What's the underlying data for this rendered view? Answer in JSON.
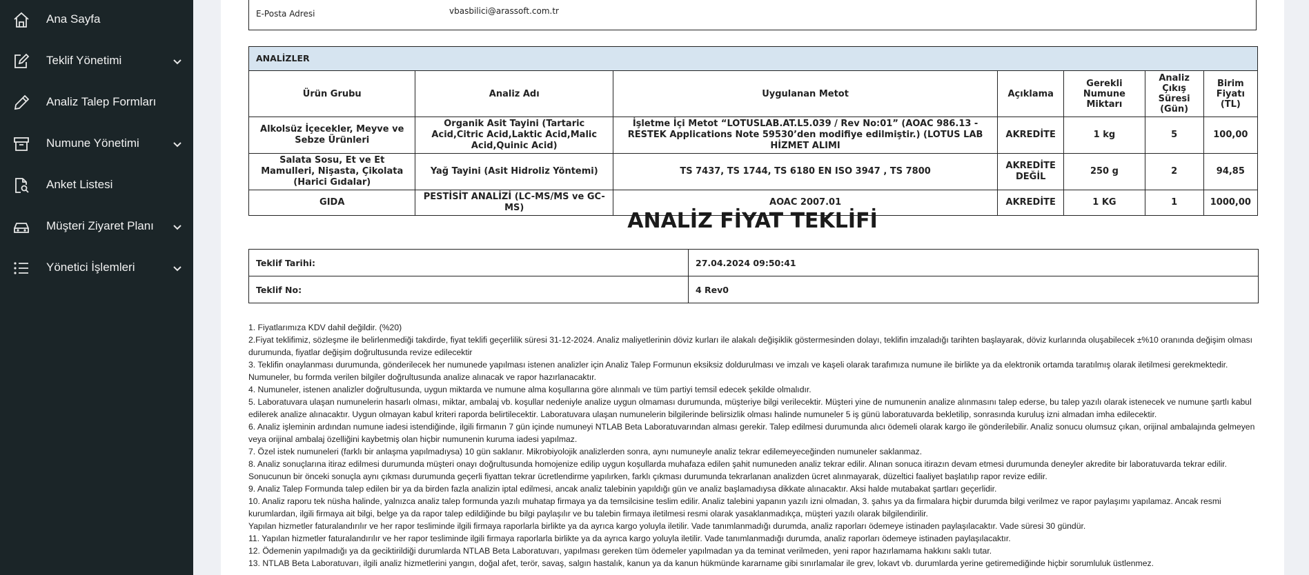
{
  "sidebar": {
    "items": [
      {
        "label": "Ana Sayfa",
        "icon": "home-icon",
        "has_submenu": false
      },
      {
        "label": "Teklif Yönetimi",
        "icon": "edit-icon",
        "has_submenu": true
      },
      {
        "label": "Analiz Talep Formları",
        "icon": "pencil-icon",
        "has_submenu": false
      },
      {
        "label": "Numune Yönetimi",
        "icon": "archive-icon",
        "has_submenu": true
      },
      {
        "label": "Anket Listesi",
        "icon": "document-search-icon",
        "has_submenu": false
      },
      {
        "label": "Müşteri Ziyaret Planı",
        "icon": "car-icon",
        "has_submenu": true
      },
      {
        "label": "Yönetici İşlemleri",
        "icon": "list-icon",
        "has_submenu": true
      }
    ]
  },
  "email": {
    "label": "E-Posta Adresi",
    "value": "vbasbilici@arassoft.com.tr"
  },
  "analyses": {
    "caption": "ANALİZLER",
    "headers": [
      "Ürün Grubu",
      "Analiz Adı",
      "Uygulanan Metot",
      "Açıklama",
      "Gerekli Numune Miktarı",
      "Analiz Çıkış Süresi (Gün)",
      "Birim Fiyatı (TL)"
    ],
    "rows": [
      [
        "Alkolsüz İçecekler, Meyve ve Sebze Ürünleri",
        "Organik Asit Tayini (Tartaric Acid,Citric Acid,Laktic Acid,Malic Acid,Quinic Acid)",
        "İşletme İçi Metot “LOTUSLAB.AT.L5.039 / Rev No:01” (AOAC 986.13 - RESTEK Applications Note 59530’den modifiye edilmiştir.) (LOTUS LAB HİZMET ALIMI",
        "AKREDİTE",
        "1 kg",
        "5",
        "100,00"
      ],
      [
        "Salata Sosu, Et ve Et Mamulleri, Nişasta, Çikolata (Harici Gıdalar)",
        "Yağ Tayini (Asit Hidroliz Yöntemi)",
        "TS 7437, TS 1744, TS 6180 EN ISO 3947 , TS 7800",
        "AKREDİTE DEĞİL",
        "250 g",
        "2",
        "94,85"
      ],
      [
        "GIDA",
        "PESTİSİT ANALİZİ (LC-MS/MS ve GC-MS)",
        "AOAC 2007.01",
        "AKREDİTE",
        "1 KG",
        "1",
        "1000,00"
      ]
    ]
  },
  "title": "ANALİZ FİYAT TEKLİFİ",
  "offer": {
    "date_label": "Teklif Tarihi:",
    "date_value": "27.04.2024 09:50:41",
    "no_label": "Teklif No:",
    "no_value": "4 Rev0"
  },
  "terms": [
    "1. Fiyatlarımıza KDV dahil değildir. (%20)",
    "2.Fiyat teklifimiz, sözleşme ile belirlenmediği takdirde, fiyat teklifi geçerlilik süresi 31-12-2024. Analiz maliyetlerinin döviz kurları ile alakalı değişiklik göstermesinden dolayı, teklifin imzaladığı tarihten başlayarak, döviz kurlarında oluşabilecek ±%10 oranında değişim olması durumunda, fiyatlar değişim doğrultusunda revize edilecektir",
    "3. Teklifin onaylanması durumunda, gönderilecek her numunede yapılması istenen analizler için Analiz Talep Formunun eksiksiz doldurulması ve imzalı ve kaşeli olarak tarafımıza numune ile birlikte ya da elektronik ortamda taratılmış olarak iletilmesi gerekmektedir. Numuneler, bu formda verilen bilgiler doğrultusunda analize alınacak ve rapor hazırlanacaktır.",
    "4. Numuneler, istenen analizler doğrultusunda, uygun miktarda ve numune alma koşullarına göre alınmalı ve tüm partiyi temsil edecek şekilde olmalıdır.",
    "5. Laboratuvara ulaşan numunelerin hasarlı olması, miktar, ambalaj vb. koşullar nedeniyle analize uygun olmaması durumunda, müşteriye bilgi verilecektir. Müşteri yine de numunenin analize alınmasını talep ederse, bu talep yazılı olarak istenecek ve numune şartlı kabul edilerek analize alınacaktır. Uygun olmayan kabul kriteri raporda belirtilecektir. Laboratuvara ulaşan numunelerin bilgilerinde belirsizlik olması halinde numuneler 5 iş günü laboratuvarda bekletilip, sonrasında kuruluş izni almadan imha edilecektir.",
    "6. Analiz işleminin ardından numune iadesi istendiğinde, ilgili firmanın 7 gün içinde numuneyi NTLAB Beta Laboratuvarından alması gerekir. Talep edilmesi durumunda alıcı ödemeli olarak kargo ile gönderilebilir. Analiz sonucu olumsuz çıkan, orijinal ambalajında gelmeyen veya orijinal ambalaj özelliğini kaybetmiş olan hiçbir numunenin kuruma iadesi yapılmaz.",
    "7. Özel istek numuneleri (farklı bir anlaşma yapılmadıysa) 10 gün saklanır. Mikrobiyolojik analizlerden sonra, aynı numuneyle analiz tekrar edilemeyeceğinden numuneler saklanmaz.",
    "8. Analiz sonuçlarına itiraz edilmesi durumunda müşteri onayı doğrultusunda homojenize edilip uygun koşullarda muhafaza edilen şahit numuneden analiz tekrar edilir. Alınan sonuca itirazın devam etmesi durumunda deneyler akredite bir laboratuvarda tekrar edilir. Sonucunun bir önceki sonuçla aynı çıkması durumunda geçerli fiyattan tekrar ücretlendirme yapılırken, farklı çıkması durumunda tekrarlanan analizden ücret alınmayarak, düzeltici faaliyet başlatılıp rapor revize edilir.",
    "9. Analiz Talep Formunda talep edilen bir ya da birden fazla analizin iptal edilmesi, ancak analiz talebinin yapıldığı gün ve analiz başlamadıysa dikkate alınacaktır. Aksi halde mutabakat şartları geçerlidir.",
    "10. Analiz raporu tek nüsha halinde, yalnızca analiz talep formunda yazılı muhatap firmaya ya da temsilcisine teslim edilir. Analiz talebini yapanın yazılı izni olmadan, 3. şahıs ya da firmalara hiçbir durumda bilgi verilmez ve rapor paylaşımı yapılamaz. Ancak resmi kurumlardan, ilgili firmaya ait bilgi, belge ya da rapor talep edildiğinde bu bilgi paylaşılır ve bu talebin firmaya iletilmesi resmi olarak yasaklanmadıkça, müşteri yazılı olarak bilgilendirilir.",
    "Yapılan hizmetler faturalandırılır ve her rapor tesliminde ilgili firmaya raporlarla birlikte ya da ayrıca kargo yoluyla iletilir. Vade tanımlanmadığı durumda, analiz raporları ödemeye istinaden paylaşılacaktır. Vade süresi 30 gündür.",
    "11. Yapılan hizmetler faturalandırılır ve her rapor tesliminde ilgili firmaya raporlarla birlikte ya da ayrıca kargo yoluyla iletilir. Vade tanımlanmadığı durumda, analiz raporları ödemeye istinaden paylaşılacaktır.",
    "12. Ödemenin yapılmadığı ya da geciktirildiği durumlarda NTLAB Beta Laboratuvarı, yapılması gereken tüm ödemeler yapılmadan ya da teminat verilmeden, yeni rapor hazırlamama hakkını saklı tutar.",
    "13. NTLAB Beta Laboratuvarı, ilgili analiz hizmetlerini yangın, doğal afet, terör, savaş, salgın hastalık, kanun ya da kanun hükmünde kararname gibi sınırlamalar ile grev, lokavt vb. durumlarda yerine getiremediğinde hiçbir sorumluluk üstlenmez."
  ],
  "colors": {
    "sidebar_bg": "#1b2528",
    "caption_bg": "#d6e4f0",
    "page_bg": "#eef0f4"
  }
}
